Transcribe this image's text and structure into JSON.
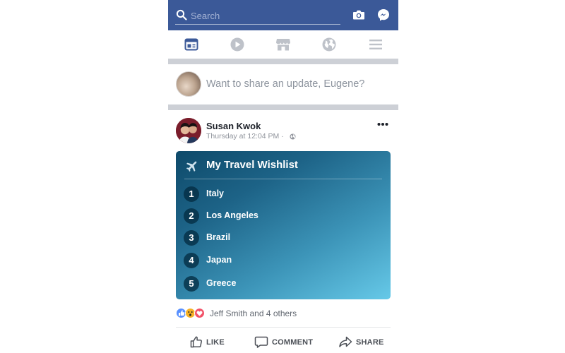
{
  "search": {
    "placeholder": "Search"
  },
  "topbar": {
    "camera_icon": "camera-icon",
    "messenger_icon": "messenger-icon"
  },
  "nav": {
    "items": [
      {
        "icon": "news-feed-icon",
        "active": true
      },
      {
        "icon": "video-play-icon",
        "active": false
      },
      {
        "icon": "marketplace-store-icon",
        "active": false
      },
      {
        "icon": "globe-notifications-icon",
        "active": false
      },
      {
        "icon": "menu-hamburger-icon",
        "active": false
      }
    ]
  },
  "composer": {
    "placeholder": "Want to share an update, Eugene?"
  },
  "post": {
    "author": "Susan Kwok",
    "timestamp": "Thursday at 12:04 PM · ",
    "privacy_icon": "globe-icon",
    "card": {
      "title": "My Travel Wishlist",
      "items": [
        {
          "number": "1",
          "label": "Italy"
        },
        {
          "number": "2",
          "label": "Los Angeles"
        },
        {
          "number": "3",
          "label": "Brazil"
        },
        {
          "number": "4",
          "label": "Japan"
        },
        {
          "number": "5",
          "label": "Greece"
        }
      ]
    },
    "reactions": {
      "icons": [
        "like-reaction-icon",
        "wow-reaction-icon",
        "love-reaction-icon"
      ],
      "text": "Jeff Smith and 4 others"
    },
    "actions": {
      "like": "LIKE",
      "comment": "COMMENT",
      "share": "SHARE"
    }
  },
  "colors": {
    "brand": "#3b5998",
    "active_nav": "#3b5998",
    "inactive_nav": "#bec2c9",
    "card_gradient_start": "#0e4a6a",
    "card_gradient_end": "#66c9e8"
  }
}
